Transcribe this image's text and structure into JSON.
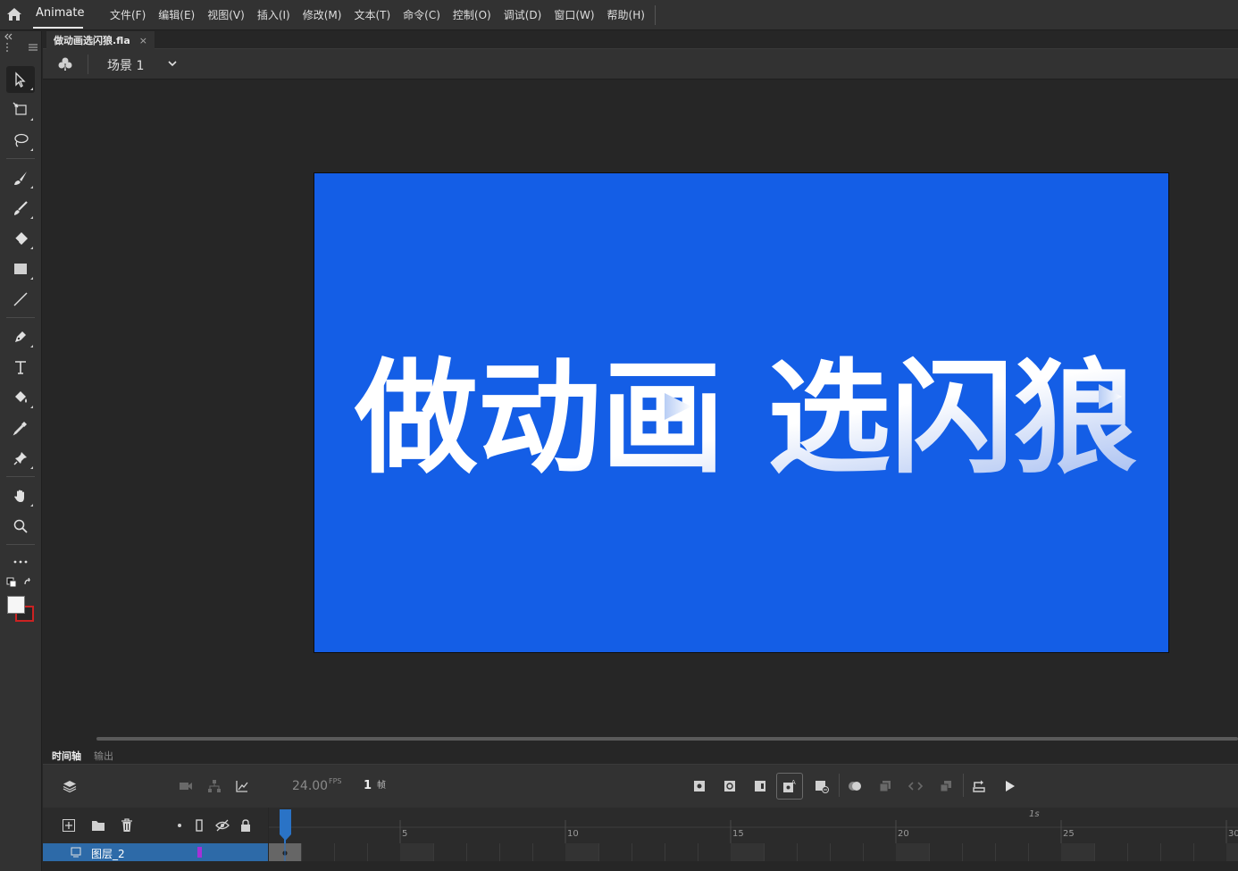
{
  "menubar": {
    "app_name": "Animate",
    "menus": [
      "文件(F)",
      "编辑(E)",
      "视图(V)",
      "插入(I)",
      "修改(M)",
      "文本(T)",
      "命令(C)",
      "控制(O)",
      "调试(D)",
      "窗口(W)",
      "帮助(H)"
    ]
  },
  "document": {
    "tab_title": "做动画选闪狼.fla",
    "close": "×"
  },
  "scene": {
    "label": "场景 1"
  },
  "stage": {
    "background": "#145ee6",
    "headline": "做动画 选闪狼"
  },
  "timeline": {
    "tabs": [
      "时间轴",
      "输出"
    ],
    "fps": "24.00",
    "fps_unit": "FPS",
    "current_frame": "1",
    "frame_unit": "帧",
    "ruler_numbers": [
      "5",
      "10",
      "15",
      "20",
      "25",
      "30"
    ],
    "ruler_seconds": "1s",
    "layer": {
      "name": "图层_2",
      "color": "#a531d6"
    }
  },
  "icons": {
    "toolbar": [
      "selection-tool-icon",
      "free-transform-icon",
      "lasso-icon",
      "paint-brush-icon",
      "brush-icon",
      "eraser-icon",
      "rectangle-icon",
      "line-icon",
      "pen-icon",
      "text-icon",
      "paint-bucket-icon",
      "eyedropper-icon",
      "pin-icon",
      "hand-icon",
      "zoom-icon",
      "more-icon"
    ]
  }
}
